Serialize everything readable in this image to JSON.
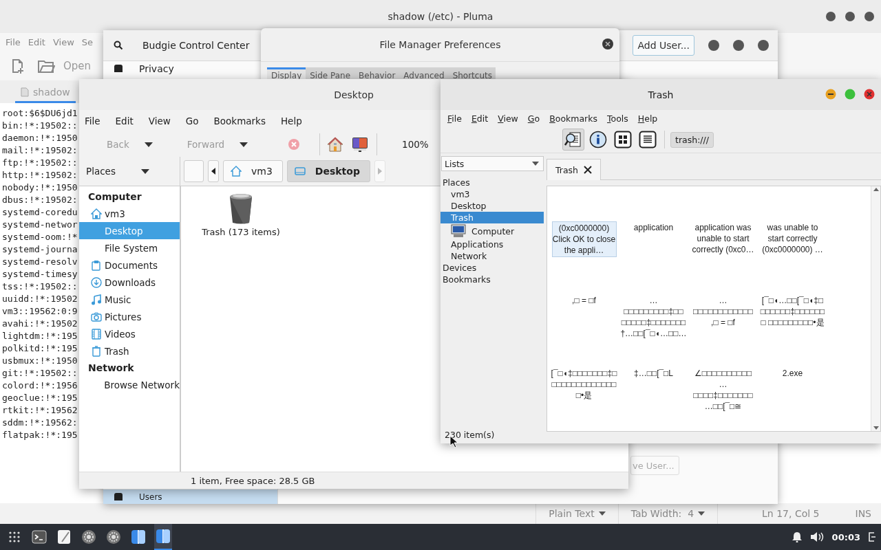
{
  "pluma": {
    "title": "shadow (/etc) - Pluma",
    "menu": [
      "File",
      "Edit",
      "View",
      "Se"
    ],
    "open_label": "Open",
    "tab": "shadow",
    "lines": [
      "root:$6$DU6jd1",
      "bin:!*:19502::",
      "daemon:!*:1950",
      "mail:!*:19502:",
      "ftp:!*:19502::",
      "http:!*:19502:",
      "nobody:!*:1950",
      "dbus:!*:19502:",
      "systemd-coredu",
      "systemd-networ",
      "systemd-oom:!*",
      "systemd-journa",
      "systemd-resolv",
      "systemd-timesy",
      "tss:!*:19502::",
      "uuidd:!*:19502",
      "vm3::19562:0:9",
      "avahi:!*:19502",
      "lightdm:!*:195",
      "polkitd:!*:195",
      "usbmux:!*:1950",
      "git:!*:19502::",
      "colord:!*:1956",
      "geoclue:!*:195",
      "rtkit:!*:19562",
      "sddm:!*:19562:",
      "flatpak:!*:195"
    ],
    "status": {
      "language": "Plain Text",
      "tab_width": "Tab Width:  4",
      "position": "Ln 17, Col 5",
      "mode": "INS"
    }
  },
  "control_center": {
    "title": "Budgie Control Center",
    "add_button": "Add User...",
    "remove_button": "ve User...",
    "sidebar": [
      {
        "label": "Privacy",
        "selected": false
      },
      {
        "label": "Users",
        "selected": true
      }
    ]
  },
  "preferences": {
    "title": "File Manager Preferences",
    "tabs": [
      {
        "label": "Display",
        "selected": true
      },
      {
        "label": "Side Pane",
        "selected": false
      },
      {
        "label": "Behavior",
        "selected": false
      },
      {
        "label": "Advanced",
        "selected": false
      },
      {
        "label": "Shortcuts",
        "selected": false
      }
    ]
  },
  "desktop_window": {
    "title": "Desktop",
    "menu": [
      "File",
      "Edit",
      "View",
      "Go",
      "Bookmarks",
      "Help"
    ],
    "toolbar": {
      "back": "Back",
      "forward": "Forward",
      "zoom": "100%"
    },
    "places_label": "Places",
    "path": [
      {
        "label": "vm3",
        "selected": false
      },
      {
        "label": "Desktop",
        "selected": true
      }
    ],
    "sidebar": [
      {
        "kind": "header",
        "label": "Computer"
      },
      {
        "kind": "item",
        "label": "vm3",
        "selected": false
      },
      {
        "kind": "item",
        "label": "Desktop",
        "selected": true
      },
      {
        "kind": "item",
        "label": "File System",
        "selected": false
      },
      {
        "kind": "item",
        "label": "Documents",
        "selected": false
      },
      {
        "kind": "item",
        "label": "Downloads",
        "selected": false
      },
      {
        "kind": "item",
        "label": "Music",
        "selected": false
      },
      {
        "kind": "item",
        "label": "Pictures",
        "selected": false
      },
      {
        "kind": "item",
        "label": "Videos",
        "selected": false
      },
      {
        "kind": "item",
        "label": "Trash",
        "selected": false
      },
      {
        "kind": "header",
        "label": "Network"
      },
      {
        "kind": "item",
        "label": "Browse Network",
        "selected": false
      }
    ],
    "files": [
      {
        "label": "Trash (173 items)"
      }
    ],
    "status": "1 item, Free space: 28.5 GB"
  },
  "trash_window": {
    "title": "Trash",
    "menu": [
      "File",
      "Edit",
      "View",
      "Go",
      "Bookmarks",
      "Tools",
      "Help"
    ],
    "location": "trash:///",
    "pane_select": "Lists",
    "tree": [
      {
        "label": "Places",
        "selected": false,
        "children": [
          {
            "label": "vm3",
            "selected": false
          },
          {
            "label": "Desktop",
            "selected": false
          },
          {
            "label": "Trash",
            "selected": true
          },
          {
            "label": "Computer",
            "selected": false
          },
          {
            "label": "Applications",
            "selected": false
          },
          {
            "label": "Network",
            "selected": false
          }
        ]
      },
      {
        "label": "Devices",
        "selected": false
      },
      {
        "label": "Bookmarks",
        "selected": false
      }
    ],
    "tab": "Trash",
    "files": [
      {
        "label": "(0xc0000000) Click OK to close the appli…",
        "selected": true
      },
      {
        "label": "application",
        "selected": false
      },
      {
        "label": "application was unable to start correctly (0xc0…",
        "selected": false
      },
      {
        "label": "was unable to start correctly (0xc0000000) …",
        "selected": false
      },
      {
        "label": ",□ = □f",
        "selected": false
      },
      {
        "label": "…□□□□□□□□□‡□□ □□□□□‡□□□□□□□ †…□□[¯□◖…□□…",
        "selected": false
      },
      {
        "label": "…□□□□□□□□□□□□ ,□ = □f",
        "selected": false
      },
      {
        "label": "[¯□◖…□□[¯□◖‡□ □□□□□□‡□□□□□□□ □□□□□□□□□•是",
        "selected": false
      },
      {
        "label": "[¯□◖‡□□□□□□□‡□ □□□□□□□□□□□□□ □•是",
        "selected": false
      },
      {
        "label": "‡…□□[¯□L",
        "selected": false
      },
      {
        "label": "∠□□□□□□□□□□ …□□□□‡□□□□□□□ …□□[¯□≅",
        "selected": false
      },
      {
        "label": "2.exe",
        "selected": false
      }
    ],
    "status": "230 item(s)"
  },
  "taskbar": {
    "apps": [
      {
        "kind": "terminal",
        "active": false
      },
      {
        "kind": "editor",
        "active": false
      },
      {
        "kind": "settings",
        "active": false
      },
      {
        "kind": "settings",
        "active": false
      },
      {
        "kind": "files",
        "active": false
      },
      {
        "kind": "files",
        "active": true
      }
    ],
    "clock": "00:03"
  }
}
